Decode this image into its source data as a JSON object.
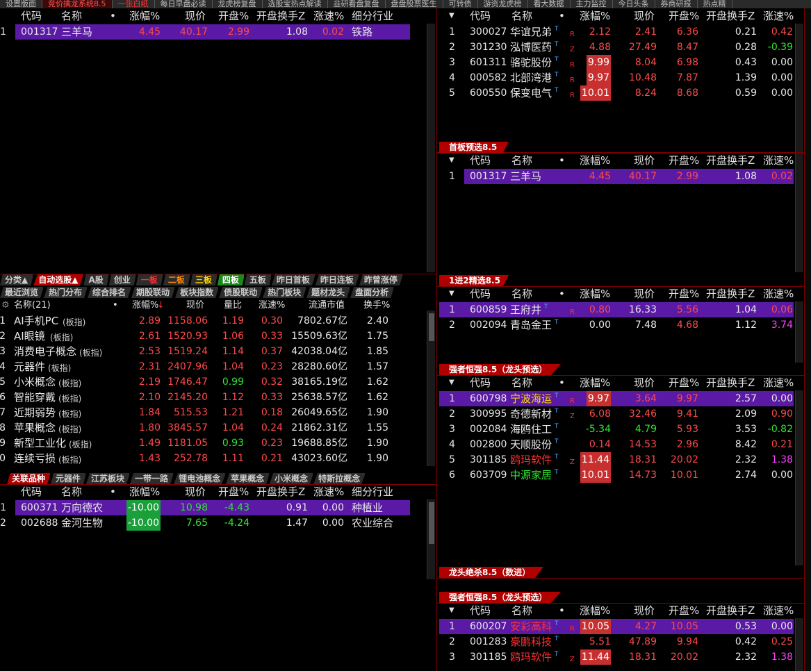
{
  "top_tabs": [
    "设置版面",
    "竞价擒龙系统8.5",
    "一张白纸",
    "每日早盘必读",
    "龙虎榜复盘",
    "选股宝热点解读",
    "韭研看盘复盘",
    "盘盘股票医生",
    "可转债",
    "游资龙虎榜",
    "看大数据",
    "主力监控",
    "今日头条",
    "券商研报",
    "热点精"
  ],
  "headers": {
    "code": "代码",
    "name": "名称",
    "dot": "•",
    "chg": "涨幅%",
    "price": "现价",
    "open": "开盘%",
    "turn": "开盘换手Z",
    "speed": "涨速%",
    "ind": "细分行业"
  },
  "left_top_rows": [
    {
      "idx": "1",
      "code": "001317",
      "name": "三羊马",
      "chg": "4.45",
      "price": "40.17",
      "open": "2.99",
      "turn": "1.08",
      "speed": "0.02",
      "ind": "铁路"
    }
  ],
  "mid_tabs_row1": [
    "分类▲",
    "自动选股▲",
    "A股",
    "创业",
    "一板",
    "二板",
    "三板",
    "四板",
    "五板",
    "昨日首板",
    "昨日连板",
    "昨曾涨停"
  ],
  "mid_tabs_row2": [
    "最近浏览",
    "热门分布",
    "综合排名",
    "期股联动",
    "板块指数",
    "债股联动",
    "热门板块",
    "题材龙头",
    "盘面分析"
  ],
  "sector_header": {
    "name": "名称(21)",
    "dot": "•",
    "chg": "涨幅%",
    "sort": "↓",
    "price": "现价",
    "vol": "量比",
    "speed": "涨速%",
    "cap": "流通市值",
    "turn": "换手%"
  },
  "sector_rows": [
    {
      "idx": "1",
      "name": "AI手机PC",
      "tag": "(板指)",
      "chg": "2.89",
      "price": "1158.06",
      "vol": "1.19",
      "speed": "0.30",
      "cap": "7802.67亿",
      "turn": "2.40"
    },
    {
      "idx": "2",
      "name": "AI眼镜",
      "tag": "(板指)",
      "chg": "2.61",
      "price": "1520.93",
      "vol": "1.06",
      "speed": "0.33",
      "cap": "15509.63亿",
      "turn": "1.75"
    },
    {
      "idx": "3",
      "name": "消费电子概念",
      "tag": "(板指)",
      "chg": "2.53",
      "price": "1519.24",
      "vol": "1.14",
      "speed": "0.37",
      "cap": "42038.04亿",
      "turn": "1.85"
    },
    {
      "idx": "4",
      "name": "元器件",
      "tag": "(板指)",
      "chg": "2.31",
      "price": "2407.96",
      "vol": "1.04",
      "speed": "0.23",
      "cap": "28280.60亿",
      "turn": "1.57"
    },
    {
      "idx": "5",
      "name": "小米概念",
      "tag": "(板指)",
      "chg": "2.19",
      "price": "1746.47",
      "vol": "0.99",
      "speed": "0.32",
      "cap": "38165.19亿",
      "turn": "1.62"
    },
    {
      "idx": "6",
      "name": "智能穿戴",
      "tag": "(板指)",
      "chg": "2.10",
      "price": "2145.20",
      "vol": "1.12",
      "speed": "0.33",
      "cap": "25638.57亿",
      "turn": "1.62"
    },
    {
      "idx": "7",
      "name": "近期弱势",
      "tag": "(板指)",
      "chg": "1.84",
      "price": "515.53",
      "vol": "1.21",
      "speed": "0.18",
      "cap": "26049.65亿",
      "turn": "1.90"
    },
    {
      "idx": "8",
      "name": "苹果概念",
      "tag": "(板指)",
      "chg": "1.80",
      "price": "3845.57",
      "vol": "1.04",
      "speed": "0.24",
      "cap": "21862.31亿",
      "turn": "1.55"
    },
    {
      "idx": "9",
      "name": "新型工业化",
      "tag": "(板指)",
      "chg": "1.49",
      "price": "1181.05",
      "vol": "0.93",
      "speed": "0.23",
      "cap": "19688.85亿",
      "turn": "1.90"
    },
    {
      "idx": "10",
      "name": "连续亏损",
      "tag": "(板指)",
      "chg": "1.43",
      "price": "252.78",
      "vol": "1.11",
      "speed": "0.21",
      "cap": "43023.60亿",
      "turn": "1.90"
    }
  ],
  "bottom_tabs": [
    "关联品种",
    "元器件",
    "江苏板块",
    "一带一路",
    "锂电池概念",
    "苹果概念",
    "小米概念",
    "特斯拉概念"
  ],
  "left_bottom_rows": [
    {
      "idx": "1",
      "code": "600371",
      "name": "万向德农",
      "chg": "-10.00",
      "price": "10.98",
      "open": "-4.43",
      "turn": "0.91",
      "speed": "0.00",
      "ind": "种植业"
    },
    {
      "idx": "2",
      "code": "002688",
      "name": "金河生物",
      "chg": "-10.00",
      "price": "7.65",
      "open": "-4.24",
      "turn": "1.47",
      "speed": "0.00",
      "ind": "农业综合"
    }
  ],
  "right_p1_rows": [
    {
      "idx": "1",
      "code": "300027",
      "name": "华谊兄弟",
      "mark": "R",
      "chg": "2.12",
      "price": "2.41",
      "open": "6.36",
      "turn": "0.21",
      "speed": "0.42"
    },
    {
      "idx": "2",
      "code": "301230",
      "name": "泓博医药",
      "mark": "Z",
      "chg": "4.88",
      "price": "27.49",
      "open": "8.47",
      "turn": "0.28",
      "speed": "-0.39"
    },
    {
      "idx": "3",
      "code": "601311",
      "name": "骆驼股份",
      "mark": "R",
      "chg": "9.99",
      "price": "8.04",
      "open": "6.98",
      "turn": "0.43",
      "speed": "0.00"
    },
    {
      "idx": "4",
      "code": "000582",
      "name": "北部湾港",
      "mark": "R",
      "chg": "9.97",
      "price": "10.48",
      "open": "7.87",
      "turn": "1.39",
      "speed": "0.00"
    },
    {
      "idx": "5",
      "code": "600550",
      "name": "保变电气",
      "mark": "R",
      "chg": "10.01",
      "price": "8.24",
      "open": "8.68",
      "turn": "0.59",
      "speed": "0.00"
    }
  ],
  "section_titles": {
    "s2": "首板预选8.5",
    "s3": "1进2精选8.5",
    "s4": "强者恒强8.5（龙头预选）",
    "s5": "龙头绝杀8.5（数进）",
    "s6": "强者恒强8.5（龙头预选）"
  },
  "right_p2_rows": [
    {
      "idx": "1",
      "code": "001317",
      "name": "三羊马",
      "chg": "4.45",
      "price": "40.17",
      "open": "2.99",
      "turn": "1.08",
      "speed": "0.02"
    }
  ],
  "right_p3_rows": [
    {
      "idx": "1",
      "code": "600859",
      "name": "王府井",
      "mark": "R",
      "chg": "0.80",
      "price": "16.33",
      "open": "5.56",
      "turn": "1.04",
      "speed": "0.06"
    },
    {
      "idx": "2",
      "code": "002094",
      "name": "青岛金王",
      "chg": "0.00",
      "price": "7.48",
      "open": "4.68",
      "turn": "1.12",
      "speed": "3.74"
    }
  ],
  "right_p4_rows": [
    {
      "idx": "1",
      "code": "600798",
      "name": "宁波海运",
      "mark": "R",
      "chg": "9.97",
      "price": "3.64",
      "open": "9.97",
      "turn": "2.57",
      "speed": "0.00"
    },
    {
      "idx": "2",
      "code": "300995",
      "name": "奇德新材",
      "mark": "Z",
      "chg": "6.08",
      "price": "32.46",
      "open": "9.41",
      "turn": "2.09",
      "speed": "0.90"
    },
    {
      "idx": "3",
      "code": "002084",
      "name": "海鸥住工",
      "chg": "-5.34",
      "price": "4.79",
      "open": "5.93",
      "turn": "3.53",
      "speed": "-0.82"
    },
    {
      "idx": "4",
      "code": "002800",
      "name": "天顺股份",
      "chg": "0.14",
      "price": "14.53",
      "open": "2.96",
      "turn": "8.42",
      "speed": "0.21"
    },
    {
      "idx": "5",
      "code": "301185",
      "name": "鸥玛软件",
      "mark": "Z",
      "chg": "11.44",
      "price": "18.31",
      "open": "20.02",
      "turn": "2.32",
      "speed": "1.38"
    },
    {
      "idx": "6",
      "code": "603709",
      "name": "中源家居",
      "chg": "10.01",
      "price": "14.73",
      "open": "10.01",
      "turn": "2.74",
      "speed": "0.00"
    }
  ],
  "right_p6_rows": [
    {
      "idx": "1",
      "code": "600207",
      "name": "安彩高科",
      "mark": "R",
      "chg": "10.05",
      "price": "4.27",
      "open": "10.05",
      "turn": "0.53",
      "speed": "0.00"
    },
    {
      "idx": "2",
      "code": "001283",
      "name": "豪鹏科技",
      "chg": "5.51",
      "price": "47.89",
      "open": "9.94",
      "turn": "0.42",
      "speed": "0.25"
    },
    {
      "idx": "3",
      "code": "301185",
      "name": "鸥玛软件",
      "mark": "Z",
      "chg": "11.44",
      "price": "18.31",
      "open": "20.02",
      "turn": "2.32",
      "speed": "1.38"
    }
  ],
  "colors": {
    "accent": "#b00000",
    "highlight": "#5a1aa5",
    "up": "#ff4a4a",
    "down": "#2de82d"
  }
}
